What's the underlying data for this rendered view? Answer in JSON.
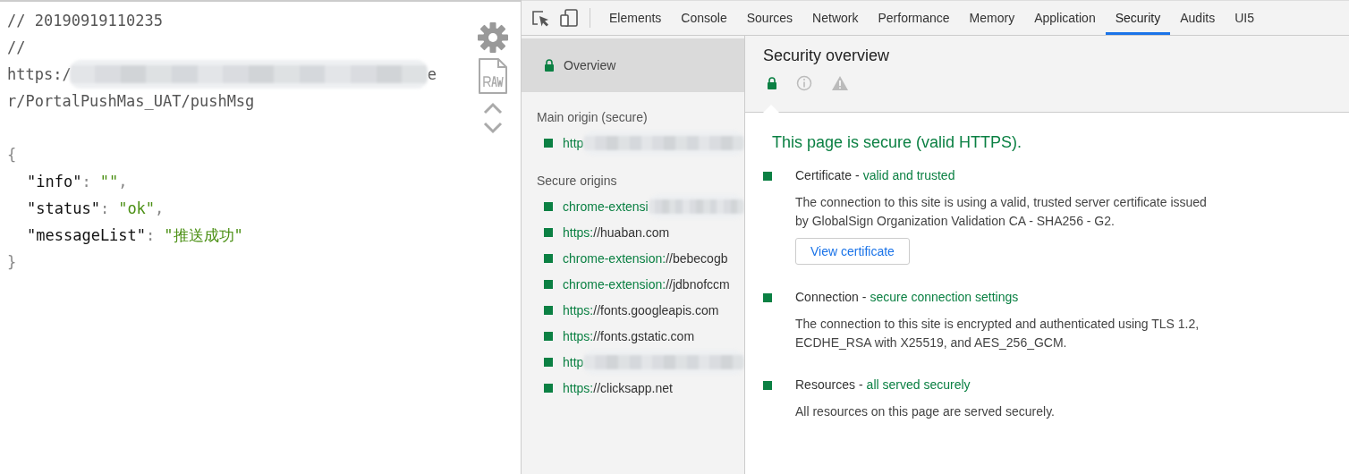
{
  "source_view": {
    "comments": [
      "// 20190919110235",
      "//"
    ],
    "url": {
      "start": "https:/",
      "redacted": true,
      "end": "e",
      "line_2": "r/PortalPushMas_UAT/pushMsg"
    },
    "json": {
      "open": "{",
      "close": "}",
      "entries": [
        {
          "key": "\"info\"",
          "sep": ":",
          "value": "\"\"",
          "trail": ","
        },
        {
          "key": "\"status\"",
          "sep": ":",
          "value": "\"ok\"",
          "trail": ","
        },
        {
          "key": "\"messageList\"",
          "sep": ":",
          "value": "\"推送成功\""
        }
      ]
    }
  },
  "devtools": {
    "tabs": [
      {
        "label": "Elements",
        "selected": false
      },
      {
        "label": "Console",
        "selected": false
      },
      {
        "label": "Sources",
        "selected": false
      },
      {
        "label": "Network",
        "selected": false
      },
      {
        "label": "Performance",
        "selected": false
      },
      {
        "label": "Memory",
        "selected": false
      },
      {
        "label": "Application",
        "selected": false
      },
      {
        "label": "Security",
        "selected": true
      },
      {
        "label": "Audits",
        "selected": false
      },
      {
        "label": "UI5",
        "selected": false
      }
    ],
    "sidebar": {
      "overview": {
        "label": "Overview",
        "selected": true
      },
      "sections": [
        {
          "title": "Main origin (secure)",
          "origins": [
            {
              "scheme": "http",
              "redacted": true
            }
          ]
        },
        {
          "title": "Secure origins",
          "origins": [
            {
              "scheme": "chrome-extensi",
              "redacted": true
            },
            {
              "scheme": "https:",
              "host": "//huaban.com",
              "redacted": false
            },
            {
              "scheme": "chrome-extension:",
              "host": "//bebecogb",
              "redacted": false
            },
            {
              "scheme": "chrome-extension:",
              "host": "//jdbnofccm",
              "redacted": false
            },
            {
              "scheme": "https:",
              "host": "//fonts.googleapis.com",
              "redacted": false
            },
            {
              "scheme": "https:",
              "host": "//fonts.gstatic.com",
              "redacted": false
            },
            {
              "scheme": "http",
              "redacted": true
            },
            {
              "scheme": "https:",
              "host": "//clicksapp.net",
              "redacted": false
            }
          ]
        }
      ]
    },
    "overview": {
      "title": "Security overview",
      "summary": "This page is secure (valid HTTPS).",
      "items": [
        {
          "title": "Certificate",
          "sep": "-",
          "status": "valid and trusted",
          "description": "The connection to this site is using a valid, trusted server certificate issued by GlobalSign Organization Validation CA - SHA256 - G2.",
          "button": "View certificate"
        },
        {
          "title": "Connection",
          "sep": "-",
          "status": "secure connection settings",
          "description": "The connection to this site is encrypted and authenticated using TLS 1.2, ECDHE_RSA with X25519, and AES_256_GCM."
        },
        {
          "title": "Resources",
          "sep": "-",
          "status": "all served securely",
          "description": "All resources on this page are served securely."
        }
      ]
    }
  }
}
